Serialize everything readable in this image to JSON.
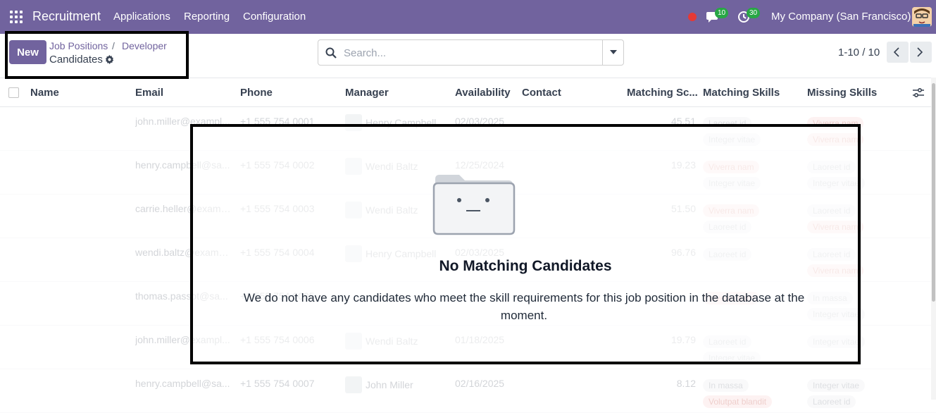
{
  "navbar": {
    "app_name": "Recruitment",
    "menu": [
      "Applications",
      "Reporting",
      "Configuration"
    ],
    "messages_count": "10",
    "activities_count": "30",
    "company": "My Company (San Francisco)",
    "color": "#71639e"
  },
  "control": {
    "new_label": "New",
    "breadcrumb": [
      "Job Positions",
      "Developer"
    ],
    "breadcrumb_separator": "/",
    "current": "Candidates",
    "search_placeholder": "Search...",
    "pager": "1-10 / 10"
  },
  "table": {
    "columns": [
      "Name",
      "Email",
      "Phone",
      "Manager",
      "Availability",
      "Contact",
      "Matching Sc...",
      "Matching Skills",
      "Missing Skills"
    ],
    "rows": [
      {
        "email": "john.miller@exampl...",
        "phone": "+1 555 754 0001",
        "manager": "Henry Campbell",
        "availability": "02/03/2025",
        "score": "45.51",
        "matching": [
          "Laoreet id",
          "Integer vitae"
        ],
        "missing": [
          "Viverra nam",
          "Viverra nam"
        ]
      },
      {
        "email": "henry.campbell@sa...",
        "phone": "+1 555 754 0002",
        "manager": "Wendi Baltz",
        "availability": "12/25/2024",
        "score": "19.23",
        "matching": [
          "Viverra nam",
          "Integer vitae"
        ],
        "missing": [
          "Laoreet id",
          "Integer vitae"
        ]
      },
      {
        "email": "carrie.heller@exampl...",
        "phone": "+1 555 754 0003",
        "manager": "Wendi Baltz",
        "availability": "",
        "score": "51.50",
        "matching": [
          "Viverra nam",
          "Laoreet id"
        ],
        "missing": [
          "Laoreet id",
          "Viverra nam"
        ]
      },
      {
        "email": "wendi.baltz@exampl...",
        "phone": "+1 555 754 0004",
        "manager": "Henry Campbell",
        "availability": "02/03/2025",
        "score": "96.76",
        "matching": [
          "Laoreet id"
        ],
        "missing": [
          "Laoreet id",
          "Viverra nam"
        ]
      },
      {
        "email": "thomas.passot@sa...",
        "phone": "+1 555 754 0005",
        "manager": "",
        "availability": "",
        "score": "",
        "matching": [
          "Viverra nam"
        ],
        "missing": [
          "In massa",
          "Integer vitae"
        ]
      },
      {
        "email": "john.miller@exampl...",
        "phone": "+1 555 754 0006",
        "manager": "Wendi Baltz",
        "availability": "01/18/2025",
        "score": "19.79",
        "matching": [
          "Laoreet id",
          "Integer vitae"
        ],
        "missing": [
          "Integer vitae"
        ]
      },
      {
        "email": "henry.campbell@sa...",
        "phone": "+1 555 754 0007",
        "manager": "John Miller",
        "availability": "02/16/2025",
        "score": "8.12",
        "matching": [
          "In massa",
          "Volutpat blandit"
        ],
        "missing": [
          "Integer vitae",
          "Laoreet id"
        ]
      }
    ]
  },
  "help": {
    "title": "No Matching Candidates",
    "body": "We do not have any candidates who meet the skill requirements for this job position in the database at the moment."
  }
}
